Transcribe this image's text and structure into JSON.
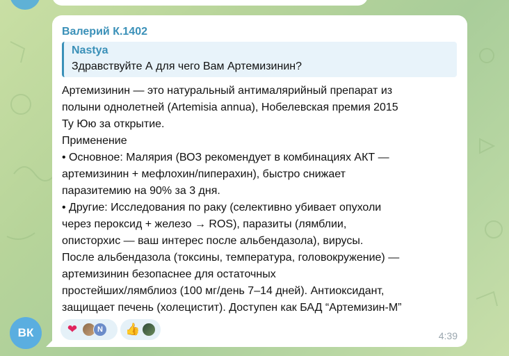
{
  "chat": {
    "message": {
      "sender_name": "Валерий К.1402",
      "reply": {
        "author": "Nastya",
        "text": "Здравствуйте А для чего Вам Артемизинин?"
      },
      "lines": [
        "Артемизинин — это натуральный антималярийный препарат из",
        "полыни однолетней (Artemisia annua), Нобелевская премия 2015",
        "Ту Юю за открытие.",
        "Применение",
        " • Основное: Малярия (ВОЗ рекомендует в комбинациях АКТ —",
        "артемизинин + мефлохин/пиперахин), быстро снижает",
        "паразитемию на 90% за 3 дня.",
        " • Другие: Исследования по раку (селективно убивает опухоли",
        "через пероксид + железо → ROS), паразиты (лямблии,",
        "описторхис — ваш интерес после альбендазола), вирусы.",
        "После альбендазола (токсины, температура, головокружение) —",
        "артемизинин безопаснее для остаточных",
        "простейших/лямблиоз (100 мг/день 7–14 дней). Антиоксидант,",
        "защищает печень (холецистит). Доступен как БАД “Артемизин-М”"
      ],
      "time": "4:39",
      "reactions": [
        {
          "emoji_icon": "heart-icon",
          "emoji": "❤️",
          "avatars": [
            "user-photo",
            "N"
          ]
        },
        {
          "emoji_icon": "thumbs-up-icon",
          "emoji": "👍",
          "avatars": [
            "user-photo-2"
          ]
        }
      ],
      "avatar_initials": "ВК"
    }
  },
  "colors": {
    "background": "#b7d49a",
    "bubble": "#ffffff",
    "accent": "#3a90b8",
    "reply_background": "#e8f3fa",
    "reaction_background": "#e5f1f8",
    "avatar": "#5aaee0",
    "time": "#9aa6ae"
  }
}
